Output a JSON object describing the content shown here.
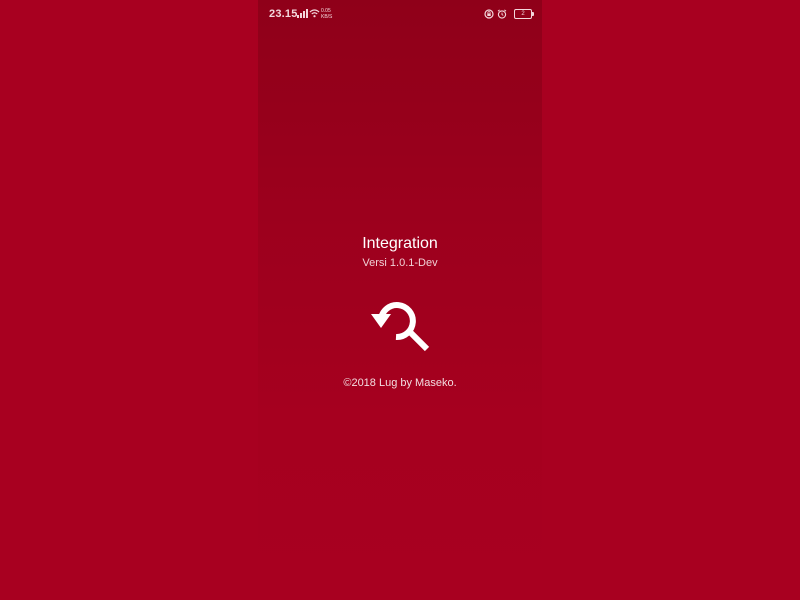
{
  "status_bar": {
    "time": "23.15",
    "net_speed_value": "0.05",
    "net_speed_unit": "KB/S",
    "battery_level": "2"
  },
  "splash": {
    "title": "Integration",
    "version": "Versi 1.0.1-Dev",
    "copyright": "©2018 Lug by Maseko.",
    "logo_icon": "refresh-search-icon"
  },
  "colors": {
    "background": "#a80020",
    "header_gradient_top": "#8f0019",
    "text": "#ffffff"
  }
}
